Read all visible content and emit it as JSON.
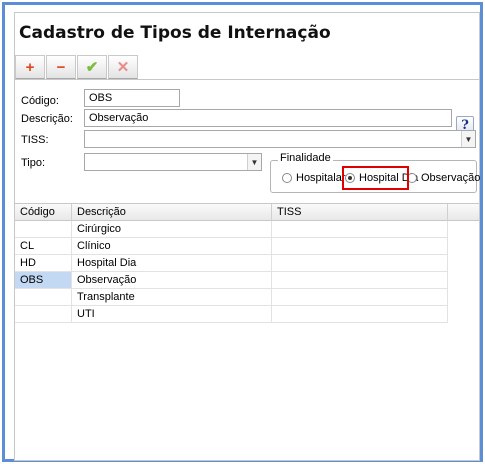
{
  "title": "Cadastro de Tipos de Internação",
  "toolbar": {
    "add": "+",
    "remove": "−",
    "confirm": "✔",
    "cancel": "✕"
  },
  "form": {
    "codigo_label": "Código:",
    "codigo_value": "OBS",
    "descricao_label": "Descrição:",
    "descricao_value": "Observação",
    "help": "?",
    "tiss_label": "TISS:",
    "tiss_value": "",
    "tipo_label": "Tipo:",
    "tipo_value": "",
    "finalidade_label": "Finalidade",
    "finalidade_options": [
      "Hospitalar",
      "Hospital Dia",
      "Observação"
    ],
    "finalidade_selected": "Hospital Dia"
  },
  "grid": {
    "columns": [
      "Código",
      "Descrição",
      "TISS"
    ],
    "rows": [
      {
        "codigo": "",
        "descricao": "Cirúrgico",
        "tiss": ""
      },
      {
        "codigo": "CL",
        "descricao": "Clínico",
        "tiss": ""
      },
      {
        "codigo": "HD",
        "descricao": "Hospital Dia",
        "tiss": ""
      },
      {
        "codigo": "OBS",
        "descricao": "Observação",
        "tiss": ""
      },
      {
        "codigo": "",
        "descricao": "Transplante",
        "tiss": ""
      },
      {
        "codigo": "",
        "descricao": "UTI",
        "tiss": ""
      }
    ],
    "selected_row": 3
  },
  "colors": {
    "window_border": "#5b8ed6",
    "selection": "#c3d9f3",
    "highlight_box": "#e00000"
  }
}
